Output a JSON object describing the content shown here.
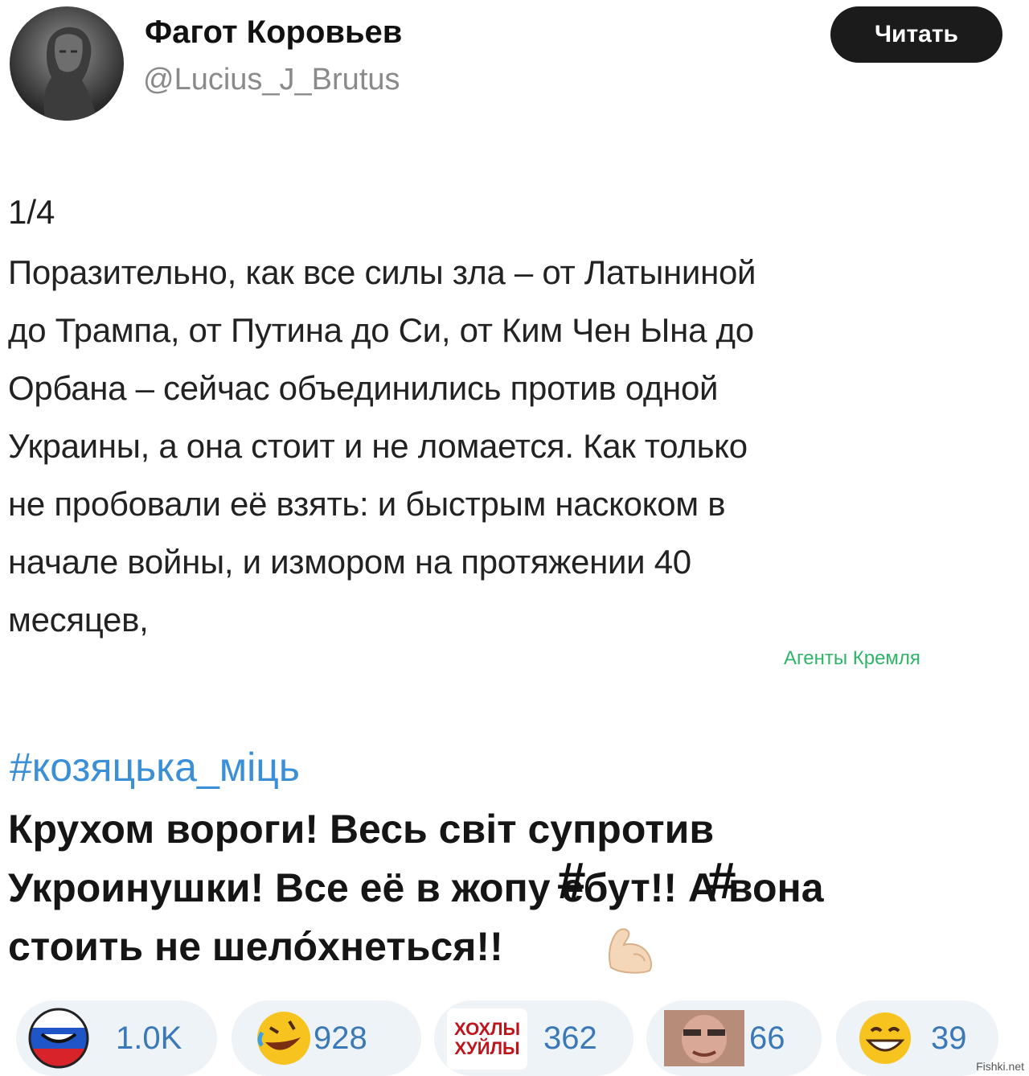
{
  "author": {
    "name": "Фагот Коровьев",
    "handle": "@Lucius_J_Brutus"
  },
  "follow_button": "Читать",
  "tweet": {
    "counter": "1/4",
    "lines": [
      "Поразительно, как все силы зла – от Латыниной",
      "до Трампа, от Путина до Си, от Ким Чен Ына до",
      "Орбана – сейчас объединились против одной",
      "Украины, а она стоит и не ломается. Как только",
      "не пробовали её взять: и быстрым наскоком в",
      "начале войны, и измором на протяжении 40",
      "месяцев,"
    ]
  },
  "overlay_label": "Агенты Кремля",
  "reply": {
    "hashtag": "#козяцька_міць",
    "lines": [
      "Крухом вороги! Весь світ супротив",
      "Укроинушки! Все её в жопу ебут!! А вона",
      "стоить не шело́хнеться!!"
    ],
    "censor_glyph": "#"
  },
  "reactions": [
    {
      "icon": "russia-flag-ball-icon",
      "count": "1.0K"
    },
    {
      "icon": "rofl-emoji-icon",
      "count": "928"
    },
    {
      "icon": "hohly-sticker-icon",
      "count": "362",
      "sticker_text_1": "ХОХЛЫ",
      "sticker_text_2": "ХУЙЛЫ"
    },
    {
      "icon": "face-photo-icon",
      "count": "66"
    },
    {
      "icon": "grin-emoji-icon",
      "count": "39"
    }
  ],
  "site_mark": "Fishki.net"
}
